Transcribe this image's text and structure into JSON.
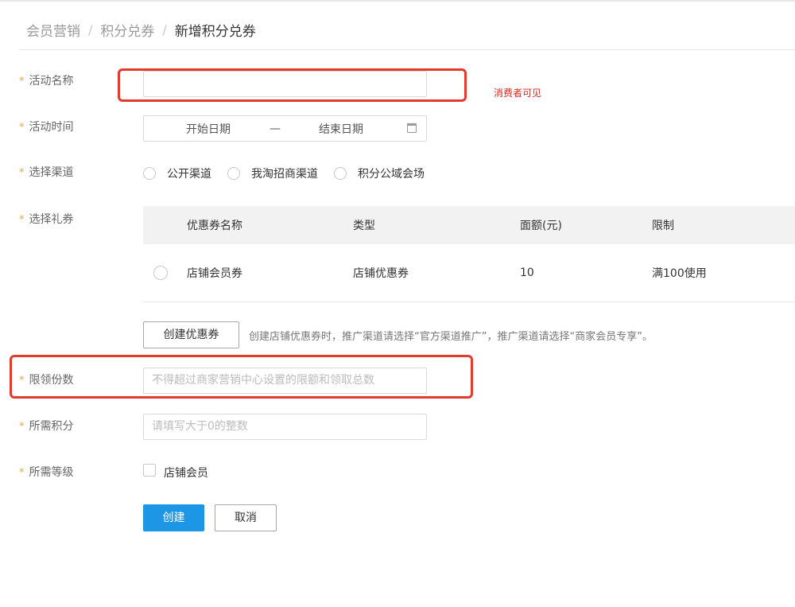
{
  "breadcrumb": {
    "items": [
      "会员营销",
      "积分兑券",
      "新增积分兑券"
    ]
  },
  "form": {
    "activity_name": {
      "label": "活动名称",
      "value": ""
    },
    "activity_time": {
      "label": "活动时间",
      "start": "开始日期",
      "dash": "—",
      "end": "结束日期"
    },
    "channel": {
      "label": "选择渠道",
      "options": [
        "公开渠道",
        "我淘招商渠道",
        "积分公域会场"
      ]
    },
    "coupon": {
      "label": "选择礼券",
      "columns": [
        "优惠券名称",
        "类型",
        "面额(元)",
        "限制"
      ],
      "rows": [
        {
          "name": "店铺会员券",
          "type": "店铺优惠券",
          "value": "10",
          "limit": "满100使用"
        }
      ],
      "create_button": "创建优惠券",
      "hint": "创建店铺优惠券时，推广渠道请选择“官方渠道推广”，推广渠道请选择“商家会员专享”。"
    },
    "limit_count": {
      "label": "限领份数",
      "placeholder": "不得超过商家营销中心设置的限额和领取总数"
    },
    "points": {
      "label": "所需积分",
      "placeholder": "请填写大于0的整数"
    },
    "level": {
      "label": "所需等级",
      "option": "店铺会员"
    },
    "star": "*"
  },
  "actions": {
    "create": "创建",
    "cancel": "取消"
  },
  "annotation": {
    "note": "消费者可见"
  },
  "colors": {
    "primary": "#1e96e6",
    "required_star": "#f5a623",
    "annotation_red": "#e23b2e"
  }
}
